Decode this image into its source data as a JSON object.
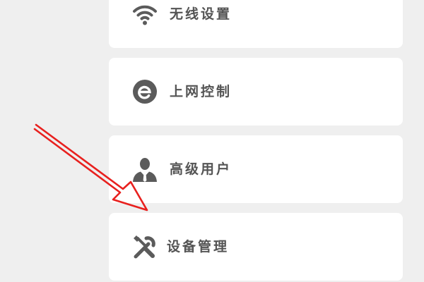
{
  "menu": {
    "items": [
      {
        "label": "无线设置",
        "icon": "wifi-icon"
      },
      {
        "label": "上网控制",
        "icon": "internet-e-icon"
      },
      {
        "label": "高级用户",
        "icon": "user-icon"
      },
      {
        "label": "设备管理",
        "icon": "tools-icon"
      }
    ]
  },
  "annotation": {
    "arrow_color": "#e8201e",
    "points_to": "设备管理"
  },
  "colors": {
    "background": "#efefef",
    "card": "#ffffff",
    "text": "#545454",
    "icon": "#5b5b5b"
  }
}
